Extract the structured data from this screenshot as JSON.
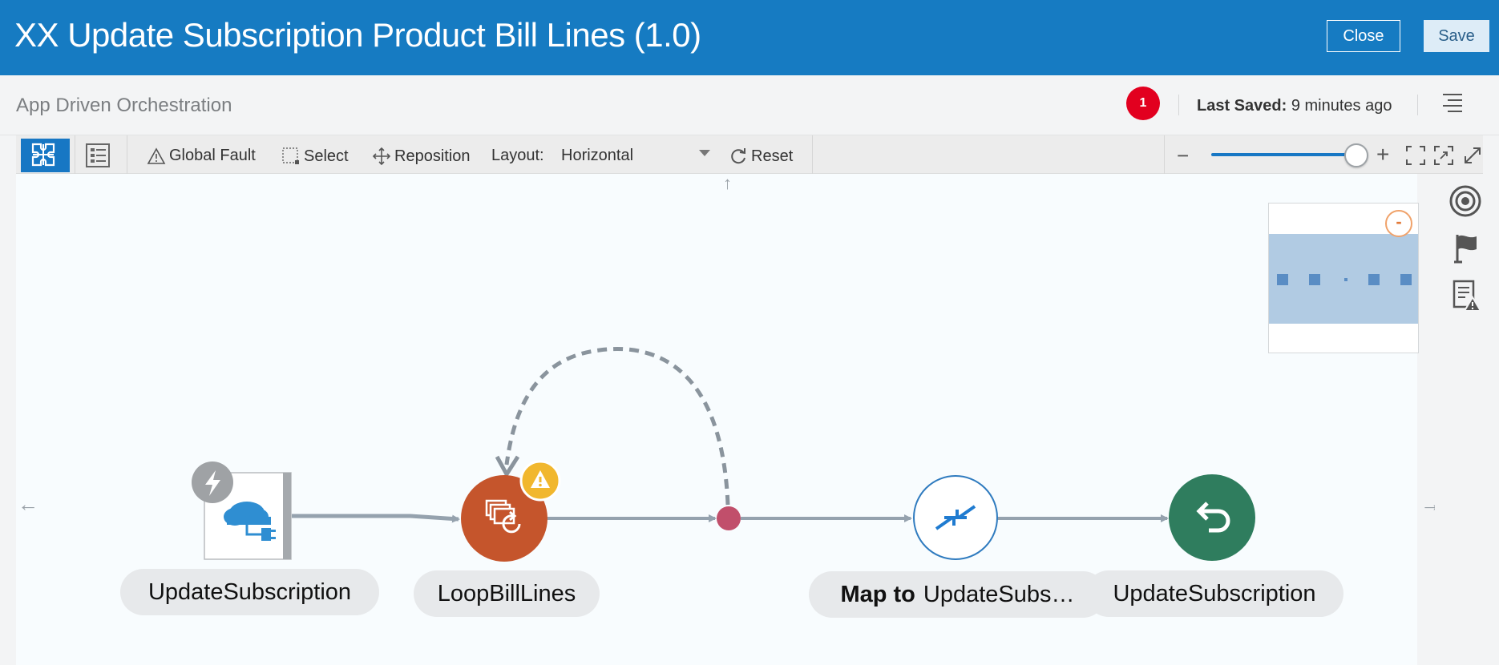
{
  "header": {
    "title": "XX Update Subscription Product Bill Lines (1.0)",
    "close_label": "Close",
    "save_label": "Save"
  },
  "subheader": {
    "breadcrumb": "App Driven Orchestration",
    "error_count": "1",
    "last_saved_label": "Last Saved:",
    "last_saved_value": "9 minutes ago"
  },
  "toolbar": {
    "global_fault": "Global Fault",
    "select": "Select",
    "reposition": "Reposition",
    "layout_label": "Layout:",
    "layout_value": "Horizontal",
    "reset": "Reset"
  },
  "nodes": [
    {
      "id": "trigger",
      "label": "UpdateSubscription",
      "icon": "cloud-plug-icon",
      "badge": "lightning-icon"
    },
    {
      "id": "loop",
      "label": "LoopBillLines",
      "icon": "for-each-loop-icon",
      "badge": "warning-icon"
    },
    {
      "id": "merge",
      "label": "",
      "icon": "merge-point-icon"
    },
    {
      "id": "map",
      "label_bold": "Map to",
      "label": "UpdateSubs…",
      "icon": "map-arrows-icon"
    },
    {
      "id": "return",
      "label": "UpdateSubscription",
      "icon": "return-arrow-icon"
    }
  ],
  "colors": {
    "header_bg": "#167bc2",
    "accent": "#1777c4",
    "loop_node": "#c5552c",
    "return_node": "#2f7d5e",
    "merge_dot": "#c14f6b",
    "error_badge": "#e2001f",
    "warning_badge": "#f1b72e",
    "connector": "#95a2ae"
  }
}
